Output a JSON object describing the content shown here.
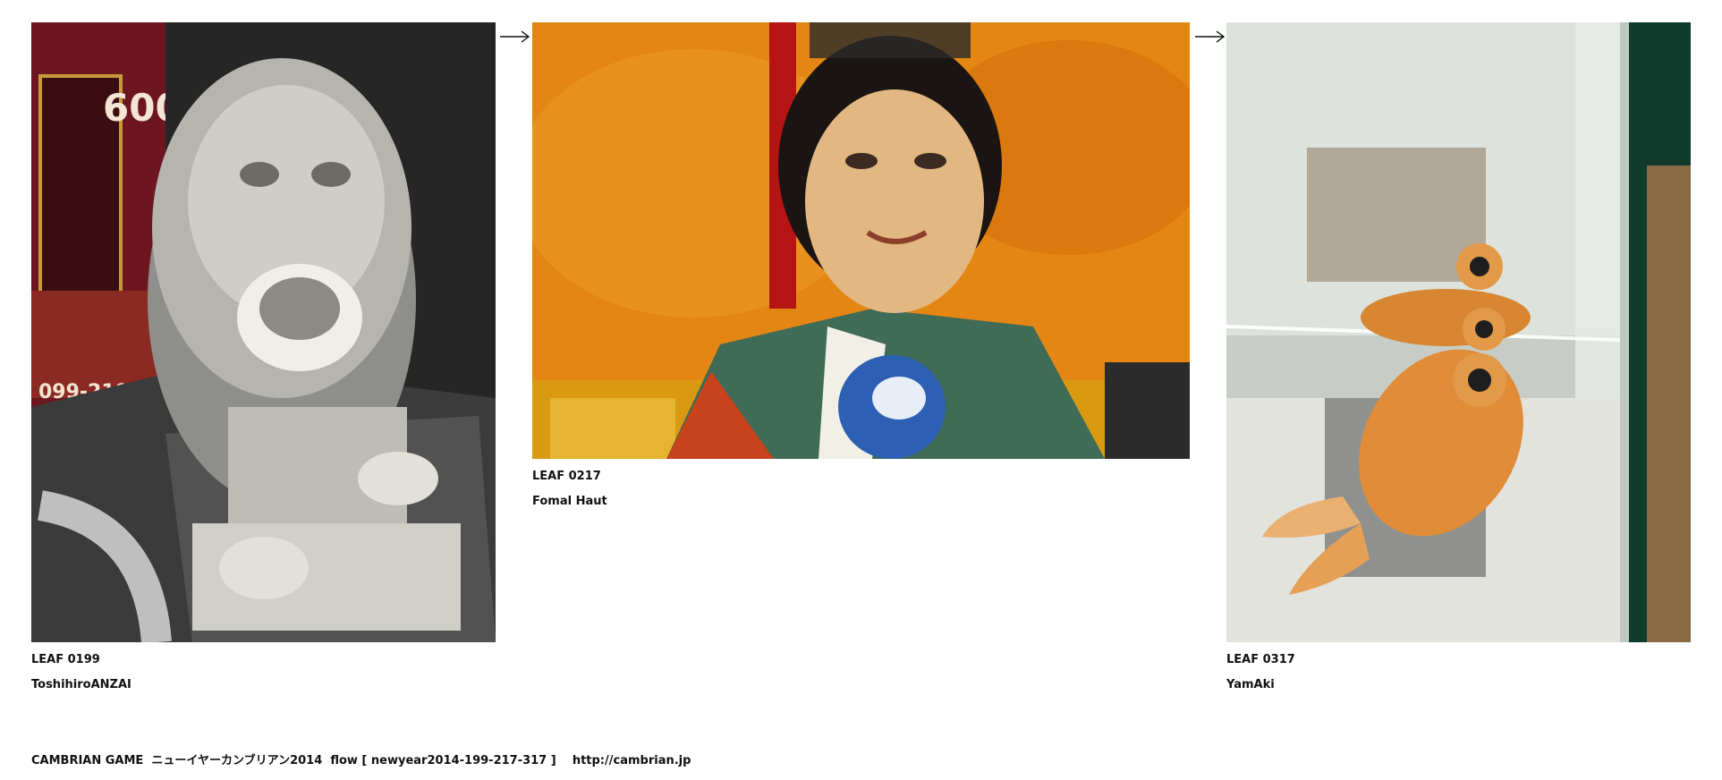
{
  "leaves": [
    {
      "id": "LEAF 0199",
      "author": "ToshihiroANZAI",
      "subject": "stone lion statue"
    },
    {
      "id": "LEAF 0217",
      "author": "Fomal Haut",
      "subject": "woman portrait on orange wall"
    },
    {
      "id": "LEAF 0317",
      "author": "YamAki",
      "subject": "goldfish in aquarium"
    }
  ],
  "sign_text": {
    "line1": "600",
    "phone": "099-219-4"
  },
  "arrow_glyph": "arrow-right-icon",
  "footer": {
    "title": "CAMBRIAN GAME",
    "subtitle": "ニューイヤーカンブリアン2014",
    "flow": "flow [ newyear2014-199-217-317 ]",
    "url": "http://cambrian.jp"
  }
}
